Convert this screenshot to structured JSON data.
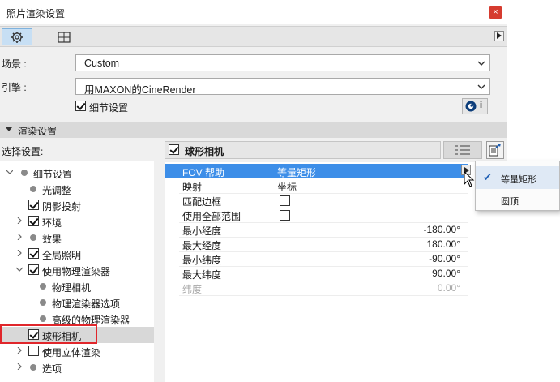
{
  "window": {
    "title": "照片渲染设置",
    "close_label": "×"
  },
  "tabs": [
    {
      "name": "settings",
      "icon": "gear-icon",
      "active": true
    },
    {
      "name": "size",
      "icon": "frame-size-icon",
      "active": false
    }
  ],
  "scene": {
    "label": "场景 :",
    "value": "Custom"
  },
  "engine": {
    "label": "引擎 :",
    "value": "用MAXON的CineRender"
  },
  "detail_settings": {
    "label": "细节设置",
    "checked": true
  },
  "info_button": {
    "label": "i"
  },
  "render_section": {
    "label": "渲染设置"
  },
  "select_settings": {
    "label": "选择设置:"
  },
  "tree": [
    {
      "label": "细节设置",
      "expander": "down",
      "marker": "dot"
    },
    {
      "label": "光调整",
      "expander": "none",
      "marker": "dot"
    },
    {
      "label": "阴影投射",
      "expander": "none",
      "marker": "checked"
    },
    {
      "label": "环境",
      "expander": "right",
      "marker": "checked"
    },
    {
      "label": "效果",
      "expander": "right",
      "marker": "dot"
    },
    {
      "label": "全局照明",
      "expander": "right",
      "marker": "checked"
    },
    {
      "label": "使用物理渲染器",
      "expander": "down",
      "marker": "checked"
    },
    {
      "label": "物理相机",
      "expander": "none",
      "marker": "dot"
    },
    {
      "label": "物理渲染器选项",
      "expander": "none",
      "marker": "dot"
    },
    {
      "label": "高级的物理渲染器",
      "expander": "none",
      "marker": "dot"
    },
    {
      "label": "球形相机",
      "expander": "none",
      "marker": "checked",
      "selected": true
    },
    {
      "label": "使用立体渲染",
      "expander": "right",
      "marker": "unchecked"
    },
    {
      "label": "选项",
      "expander": "right",
      "marker": "dot"
    }
  ],
  "panel": {
    "title": "球形相机",
    "checked": true
  },
  "properties": [
    {
      "key": "FOV 帮助",
      "value": "等量矩形",
      "selected": true
    },
    {
      "key": "映射",
      "value": "坐标"
    },
    {
      "key": "匹配边框",
      "checkbox": false
    },
    {
      "key": "使用全部范围",
      "checkbox": false
    },
    {
      "key": "最小经度",
      "value_right": "-180.00°"
    },
    {
      "key": "最大经度",
      "value_right": "180.00°"
    },
    {
      "key": "最小纬度",
      "value_right": "-90.00°"
    },
    {
      "key": "最大纬度",
      "value_right": "90.00°"
    },
    {
      "key": "纬度",
      "value_right": "0.00°",
      "disabled": true
    }
  ],
  "popup_menu": [
    {
      "label": "等量矩形",
      "checked": true
    },
    {
      "label": "圆顶",
      "checked": false
    }
  ],
  "colors": {
    "selection": "#3d8ee8",
    "highlight_box": "#e0262b",
    "active_tab": "#c7dff4",
    "close_button": "#d63b2f"
  }
}
